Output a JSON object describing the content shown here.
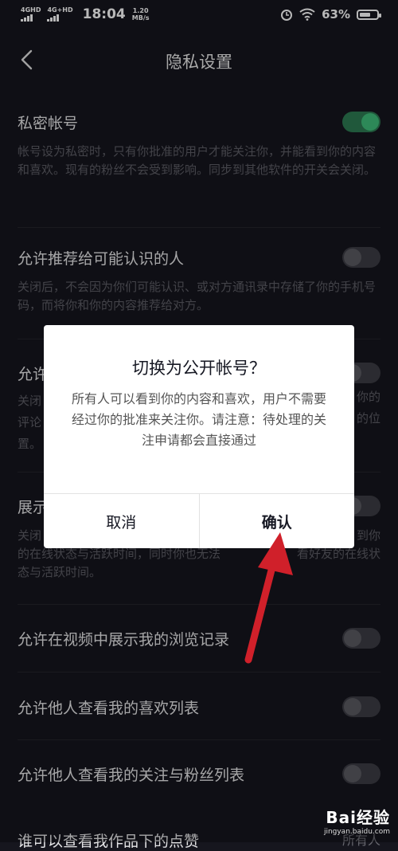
{
  "status": {
    "net1": "4GHD",
    "net2": "4G+HD",
    "time": "18:04",
    "speed_value": "1.20",
    "speed_unit": "MB/s",
    "battery": "63%",
    "battery_level": 0.63
  },
  "nav": {
    "title": "隐私设置",
    "back_icon": "chevron-left-icon"
  },
  "settings": [
    {
      "title": "私密帐号",
      "desc": "帐号设为私密时，只有你批准的用户才能关注你，并能看到你的内容和喜欢。现有的粉丝不会受到影响。同步到其他软件的开关会关闭。",
      "on": true
    },
    {
      "title": "允许推荐给可能认识的人",
      "desc": "关闭后，不会因为你们可能认识、或对方通讯录中存储了你的手机号码，而将你和你的内容推荐给对方。",
      "on": false
    },
    {
      "title": "允许",
      "desc_lines": [
        "关闭",
        "评论",
        "置。"
      ],
      "desc_right": [
        "你的",
        "的位"
      ],
      "on": false
    },
    {
      "title": "展示",
      "desc_line1": "关闭",
      "desc_right": "到你",
      "desc_line2a": "的在线状态与活跃时间，同时你也无法",
      "desc_line2b": "看好友的在线状",
      "desc_line3": "态与活跃时间。",
      "on": false
    },
    {
      "title": "允许在视频中展示我的浏览记录",
      "on": false
    },
    {
      "title": "允许他人查看我的喜欢列表",
      "on": false
    },
    {
      "title": "允许他人查看我的关注与粉丝列表",
      "on": false
    },
    {
      "title": "谁可以查看我作品下的点赞",
      "value": "所有人"
    }
  ],
  "dialog": {
    "title": "切换为公开帐号？",
    "body": "所有人可以看到你的内容和喜欢，用户不需要经过你的批准来关注你。请注意：待处理的关注申请都会直接通过",
    "cancel": "取消",
    "confirm": "确认"
  },
  "colors": {
    "toggle_on": "#3fbe7a",
    "annotation_arrow": "#d0202a"
  },
  "watermark": {
    "main": "Bai经验",
    "sub": "jingyan.baidu.com"
  }
}
